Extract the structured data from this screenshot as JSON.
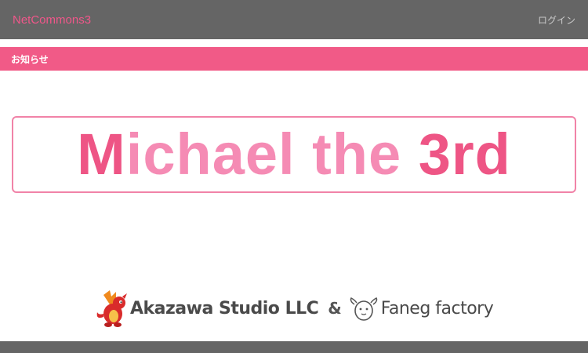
{
  "header": {
    "brand": "NetCommons3",
    "login_label": "ログイン"
  },
  "section": {
    "title": "お知らせ"
  },
  "banner": {
    "parts": [
      {
        "text": "M",
        "tone": "deep"
      },
      {
        "text": "ichael the ",
        "tone": "light"
      },
      {
        "text": "3rd",
        "tone": "deep"
      }
    ]
  },
  "credit": {
    "company1": "Akazawa Studio LLC",
    "amp": "&",
    "company2": "Faneg factory"
  },
  "colors": {
    "header_bg": "#656565",
    "brand": "#f0578a",
    "accent": "#f15a87",
    "banner_deep": "#ee5585",
    "banner_light": "#f58bb4"
  },
  "icons": {
    "dragon": "dragon-logo",
    "faneg": "egg-with-wings-logo"
  }
}
